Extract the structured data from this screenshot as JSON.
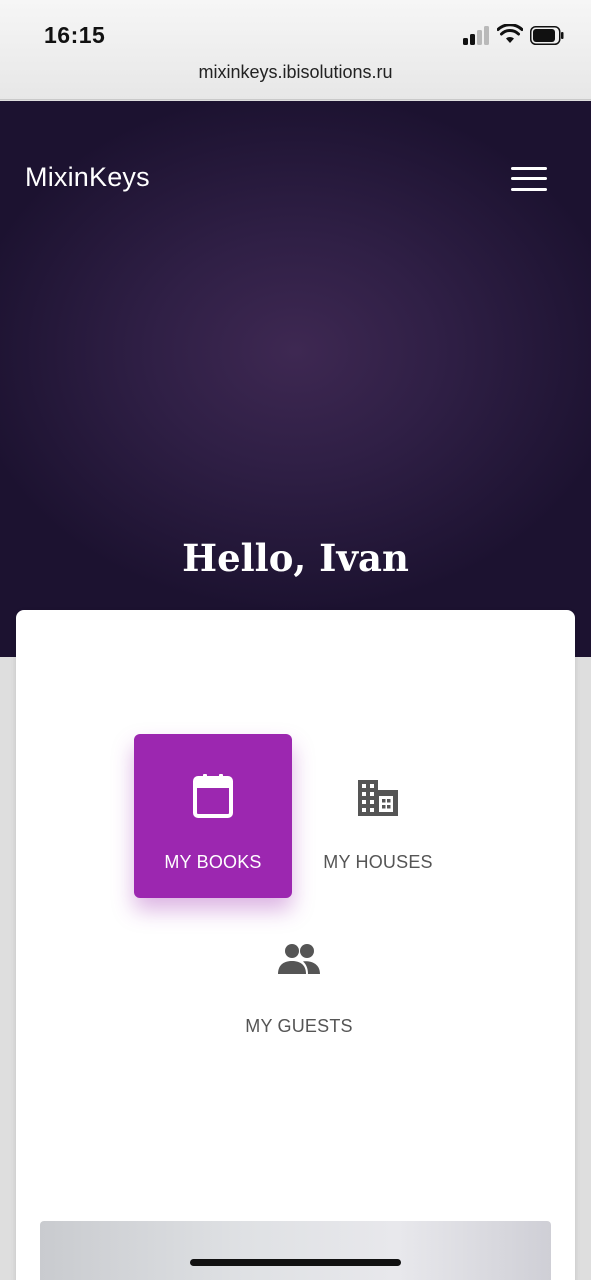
{
  "status_bar": {
    "time": "16:15",
    "url": "mixinkeys.ibisolutions.ru"
  },
  "header": {
    "brand": "MixinKeys",
    "menu_icon": "hamburger-menu-icon"
  },
  "hero": {
    "greeting": "Hello, Ivan"
  },
  "menu": {
    "items": [
      {
        "label": "MY BOOKS",
        "icon": "calendar-icon",
        "active": true
      },
      {
        "label": "MY HOUSES",
        "icon": "building-icon",
        "active": false
      },
      {
        "label": "MY GUESTS",
        "icon": "people-icon",
        "active": false
      }
    ]
  },
  "colors": {
    "accent": "#9c27b0",
    "hero_dark": "#1c1230",
    "icon_gray": "#555555"
  }
}
